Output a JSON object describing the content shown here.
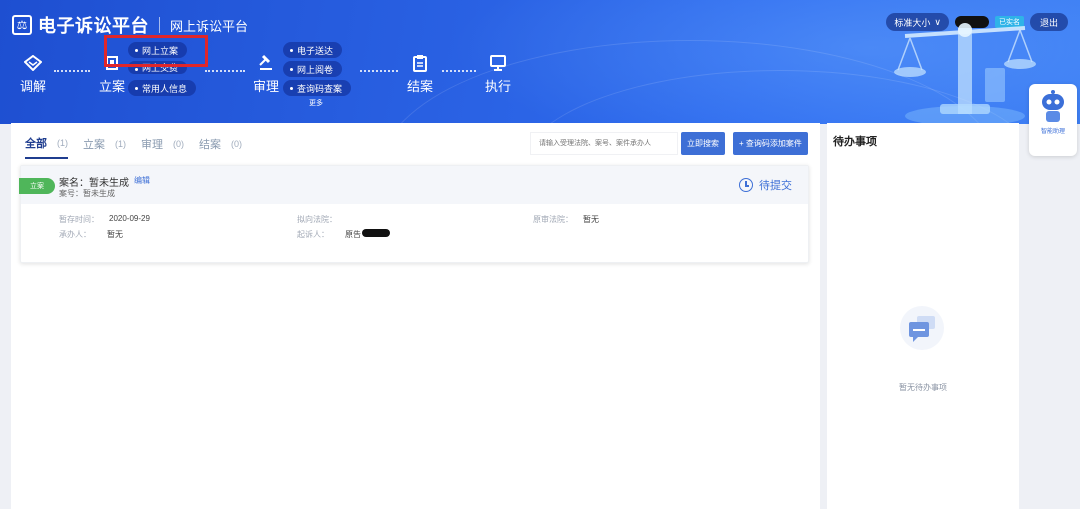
{
  "header": {
    "brand": "电子诉讼平台",
    "sub_brand": "网上诉讼平台",
    "size_select": "标准大小",
    "role_badge": "已实名",
    "logout": "退出"
  },
  "flow": {
    "nodes": [
      {
        "label": "调解",
        "icon": "diamond-icon"
      },
      {
        "label": "立案",
        "icon": "building-icon"
      },
      {
        "label": "审理",
        "icon": "gavel-icon"
      },
      {
        "label": "结案",
        "icon": "clipboard-icon"
      },
      {
        "label": "执行",
        "icon": "monitor-icon"
      }
    ],
    "lian_items": [
      "网上立案",
      "网上交费",
      "常用人信息"
    ],
    "shenli_items": [
      "电子送达",
      "网上阅卷",
      "查询码查案"
    ],
    "more": "更多"
  },
  "robot": {
    "label": "智能助理"
  },
  "tabs": [
    {
      "label": "全部",
      "count": "(1)"
    },
    {
      "label": "立案",
      "count": "(1)"
    },
    {
      "label": "审理",
      "count": "(0)"
    },
    {
      "label": "结案",
      "count": "(0)"
    }
  ],
  "search": {
    "placeholder": "请输入受理法院、案号、案件承办人",
    "search_button": "立即搜索",
    "add_button": "+ 查询码添加案件"
  },
  "case_card": {
    "status_tag": "立案",
    "name_label": "案名：",
    "name_value": "暂未生成",
    "edit": "编辑",
    "case_no_label": "案号：",
    "case_no_value": "暂未生成",
    "pending": "待提交",
    "fields": {
      "save_time_label": "暂存时间：",
      "save_time_value": "2020-09-29",
      "court_label": "拟向法院：",
      "court_value": "",
      "original_court_label": "原审法院：",
      "original_court_value": "暂无",
      "handler_label": "承办人：",
      "handler_value": "暂无",
      "submitter_label": "起诉人：",
      "submitter_value": "原告"
    }
  },
  "side": {
    "title": "待办事项",
    "empty": "暂无待办事项"
  }
}
